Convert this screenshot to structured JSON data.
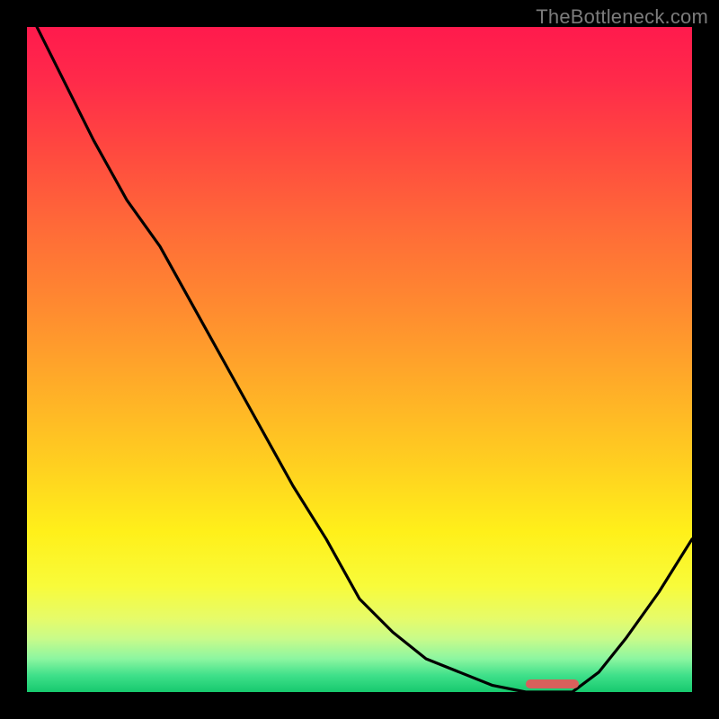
{
  "watermark": "TheBottleneck.com",
  "colors": {
    "gradient_top": "#ff1a4d",
    "gradient_mid": "#ffd020",
    "gradient_bottom_green": "#17c96e",
    "curve": "#000000",
    "marker": "#d9605c",
    "frame": "#000000"
  },
  "chart_data": {
    "type": "line",
    "title": "",
    "xlabel": "",
    "ylabel": "",
    "xlim": [
      0,
      100
    ],
    "ylim": [
      0,
      100
    ],
    "grid": false,
    "legend_position": "none",
    "x": [
      0,
      5,
      10,
      15,
      20,
      25,
      30,
      35,
      40,
      45,
      50,
      55,
      60,
      65,
      70,
      75,
      78,
      82,
      86,
      90,
      95,
      100
    ],
    "values": [
      103,
      93,
      83,
      74,
      67,
      58,
      49,
      40,
      31,
      23,
      14,
      9,
      5,
      3,
      1,
      0,
      0,
      0,
      3,
      8,
      15,
      23
    ],
    "marker": {
      "x_start": 75,
      "x_end": 83,
      "y": 0
    },
    "notes": "y is a bottleneck-style metric (0 at optimum); values read off curve as fraction of plot height."
  }
}
